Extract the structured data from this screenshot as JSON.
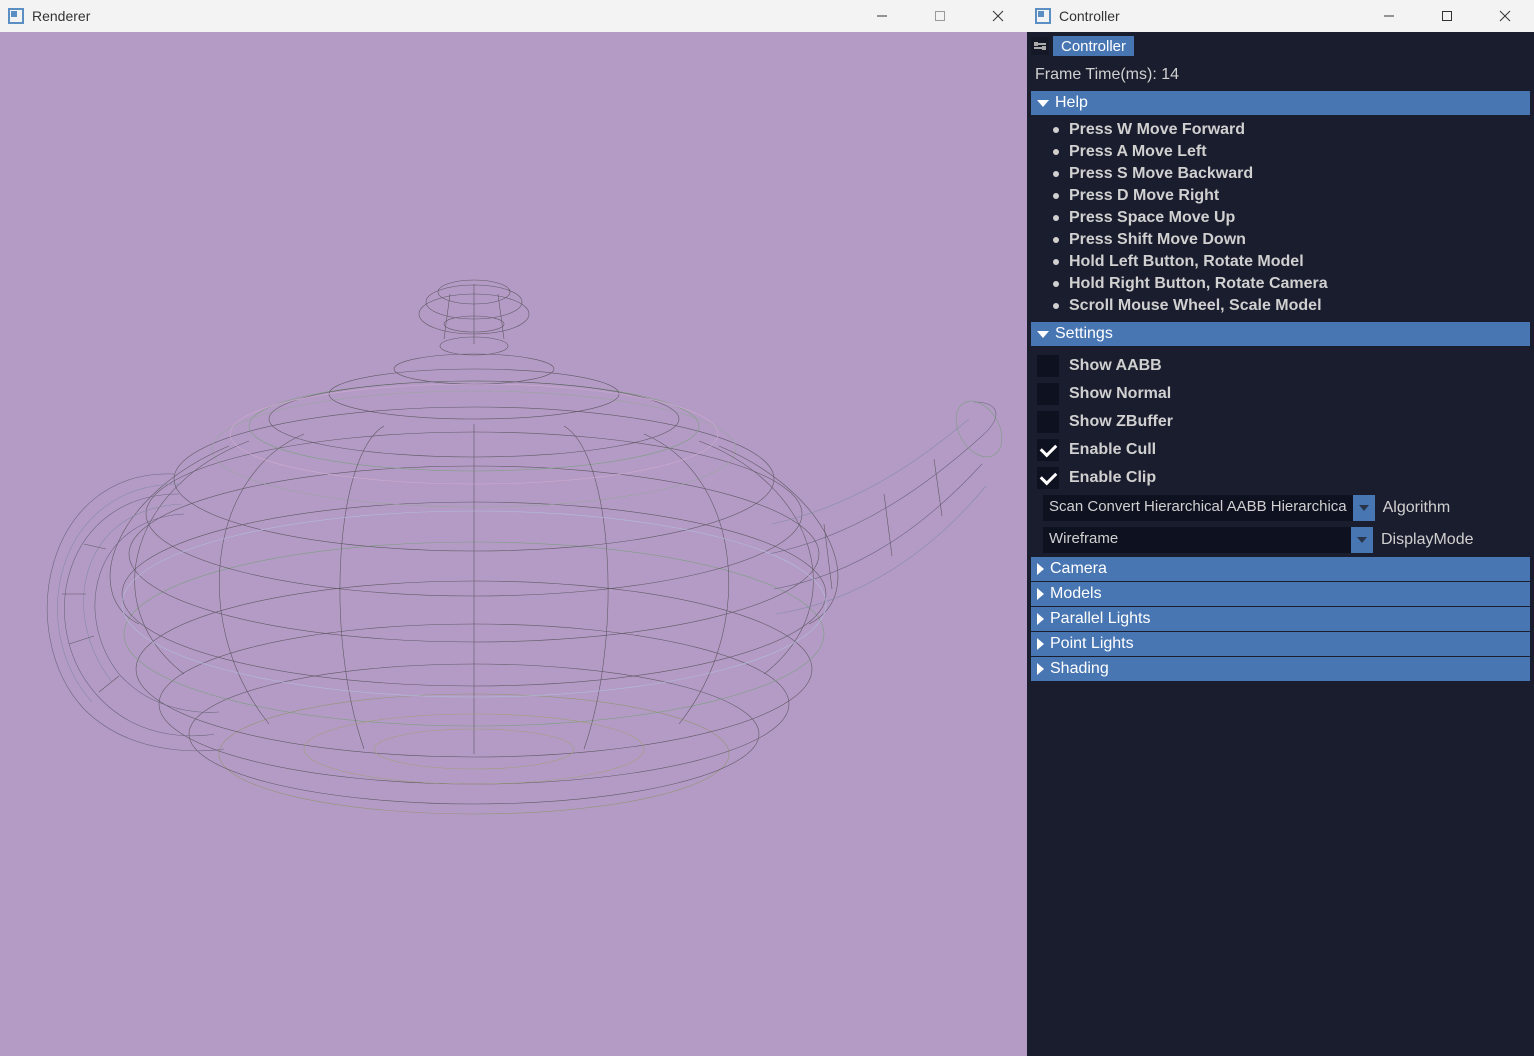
{
  "renderer": {
    "title": "Renderer"
  },
  "controller": {
    "title": "Controller",
    "tab": "Controller",
    "frameTime": "Frame Time(ms): 14",
    "help": {
      "title": "Help",
      "items": [
        "Press W Move Forward",
        "Press A Move Left",
        "Press S Move Backward",
        "Press D Move Right",
        "Press Space Move Up",
        "Press Shift Move Down",
        "Hold Left Button, Rotate Model",
        "Hold Right Button, Rotate Camera",
        "Scroll Mouse Wheel, Scale Model"
      ]
    },
    "settings": {
      "title": "Settings",
      "checks": [
        {
          "label": "Show AABB",
          "checked": false
        },
        {
          "label": "Show Normal",
          "checked": false
        },
        {
          "label": "Show ZBuffer",
          "checked": false
        },
        {
          "label": "Enable Cull",
          "checked": true
        },
        {
          "label": "Enable Clip",
          "checked": true
        }
      ],
      "algorithm": {
        "value": "Scan Convert Hierarchical AABB Hierarchica",
        "label": "Algorithm"
      },
      "displayMode": {
        "value": "Wireframe",
        "label": "DisplayMode"
      }
    },
    "collapsed": [
      "Camera",
      "Models",
      "Parallel Lights",
      "Point Lights",
      "Shading"
    ]
  }
}
